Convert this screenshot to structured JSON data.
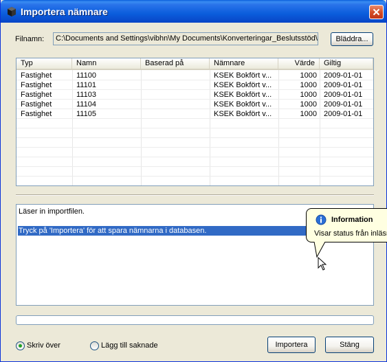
{
  "window": {
    "title": "Importera nämnare",
    "close_icon": "close-icon"
  },
  "file": {
    "label": "Filnamn:",
    "path": "C:\\Documents and Settings\\vibhn\\My Documents\\Konverteringar_Beslutsstöd\\S",
    "browse_label": "Bläddra..."
  },
  "grid": {
    "columns": [
      "Typ",
      "Namn",
      "Baserad på",
      "Nämnare",
      "Värde",
      "Giltig"
    ],
    "rows": [
      [
        "Fastighet",
        "11100",
        "",
        "KSEK Bokfört v...",
        "1000",
        "2009-01-01"
      ],
      [
        "Fastighet",
        "11101",
        "",
        "KSEK Bokfört v...",
        "1000",
        "2009-01-01"
      ],
      [
        "Fastighet",
        "11103",
        "",
        "KSEK Bokfört v...",
        "1000",
        "2009-01-01"
      ],
      [
        "Fastighet",
        "11104",
        "",
        "KSEK Bokfört v...",
        "1000",
        "2009-01-01"
      ],
      [
        "Fastighet",
        "11105",
        "",
        "KSEK Bokfört v...",
        "1000",
        "2009-01-01"
      ]
    ]
  },
  "log": {
    "lines": [
      "Läser in importfilen.",
      "Tryck på 'Importera' för att spara nämnarna i databasen."
    ],
    "selected_index": 1
  },
  "progress": {
    "value": 0
  },
  "options": {
    "overwrite_label": "Skriv över",
    "append_label": "Lägg till saknade",
    "selected": "overwrite"
  },
  "buttons": {
    "import_label": "Importera",
    "close_label": "Stäng"
  },
  "tooltip": {
    "icon": "info-icon",
    "title": "Information",
    "text": "Visar status från inläsn"
  },
  "colors": {
    "titlebar": "#0a5edc",
    "selection": "#316ac5",
    "tooltip_bg": "#ffffe1",
    "radio_dot": "#21a121"
  }
}
